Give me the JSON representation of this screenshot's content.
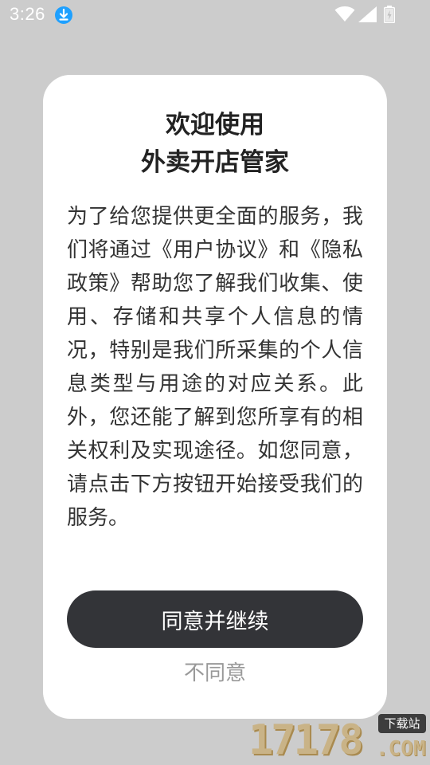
{
  "status_bar": {
    "time": "3:26",
    "icons": [
      "download-icon",
      "wifi-icon",
      "signal-icon",
      "battery-icon"
    ],
    "download_icon_color": "#1ea0ff"
  },
  "dialog": {
    "title_line1": "欢迎使用",
    "title_line2": "外卖开店管家",
    "body": "为了给您提供更全面的服务，我们将通过《用户协议》和《隐私政策》帮助您了解我们收集、使用、存储和共享个人信息的情况，特别是我们所采集的个人信息类型与用途的对应关系。此外，您还能了解到您所享有的相关权利及实现途径。如您同意，请点击下方按钮开始接受我们的服务。",
    "agree_label": "同意并继续",
    "disagree_label": "不同意",
    "agree_button_color": "#333438",
    "disagree_text_color": "#999999"
  },
  "watermark": {
    "digits": "17178",
    "suffix": ".COM",
    "badge": "下载站"
  }
}
